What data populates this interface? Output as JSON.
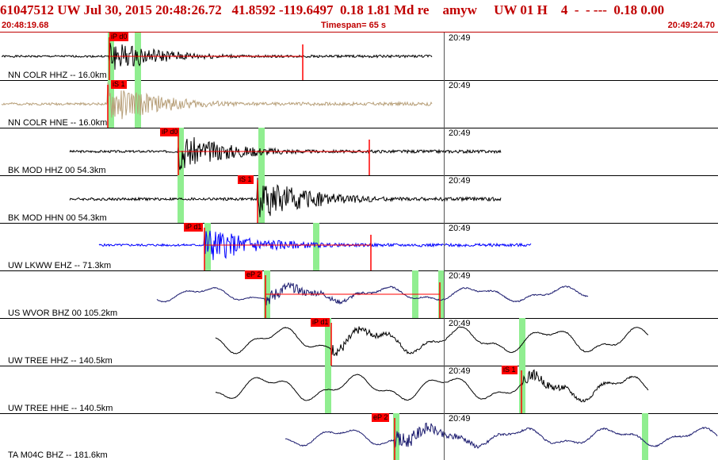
{
  "header": {
    "title": "61047512 UW Jul 30, 2015 20:48:26.72   41.8592 -119.6497  0.18 1.81 Md re    amyw     UW 01 H    4  -  - ---  0.18 0.00",
    "start_time": "20:48:19.68",
    "timespan": "Timespan=  65 s",
    "end_time": "20:49:24.70"
  },
  "colors": {
    "header_red": "#c00000",
    "pick_red": "#ff0000",
    "window_green": "#90ee90"
  },
  "panels": [
    {
      "label": "NN COLR HHZ -- 16.0km",
      "time_mark": "20:49",
      "pick": "iP d0",
      "color": "#000000"
    },
    {
      "label": "NN COLR HNE -- 16.0km",
      "time_mark": "20:49",
      "pick": "iS 1",
      "color": "#b8a07a"
    },
    {
      "label": "BK MOD HHZ 00 54.3km",
      "time_mark": "20:49",
      "pick": "iP d0",
      "color": "#000000"
    },
    {
      "label": "BK MOD HHN 00 54.3km",
      "time_mark": "20:49",
      "pick": "iS 1",
      "color": "#000000"
    },
    {
      "label": "UW LKWW EHZ -- 71.3km",
      "time_mark": "20:49",
      "pick": "iP d1",
      "color": "#0000ff"
    },
    {
      "label": "US WVOR BHZ 00 105.2km",
      "time_mark": "20:49",
      "pick": "eP 2",
      "color": "#1a1a6e"
    },
    {
      "label": "UW TREE HHZ -- 140.5km",
      "time_mark": "20:49",
      "pick": "iP d1",
      "color": "#000000"
    },
    {
      "label": "UW TREE HHE -- 140.5km",
      "time_mark": "20:49",
      "pick": "iS 1",
      "color": "#000000"
    },
    {
      "label": "TA M04C BHZ -- 181.6km",
      "time_mark": "20:49",
      "pick": "eP 2",
      "color": "#1a1a6e"
    }
  ]
}
